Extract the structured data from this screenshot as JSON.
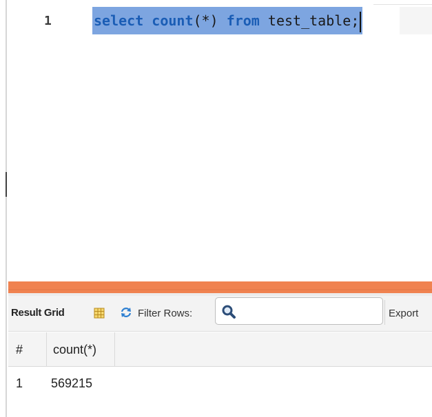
{
  "editor": {
    "line_number": "1",
    "tokens": {
      "kw_select": "select",
      "fn_count": "count",
      "args": "(*)",
      "kw_from": "from",
      "table": "test_table;"
    }
  },
  "toolbar": {
    "result_grid_label": "Result Grid",
    "filter_rows_label": "Filter Rows:",
    "filter_value": "",
    "export_label": "Export"
  },
  "grid": {
    "columns": [
      "#",
      "count(*)"
    ],
    "rows": [
      [
        "1",
        "569215"
      ]
    ]
  },
  "colors": {
    "selection": "#7da5e0",
    "keyword": "#1a5db5",
    "splitter": "#f08250"
  }
}
